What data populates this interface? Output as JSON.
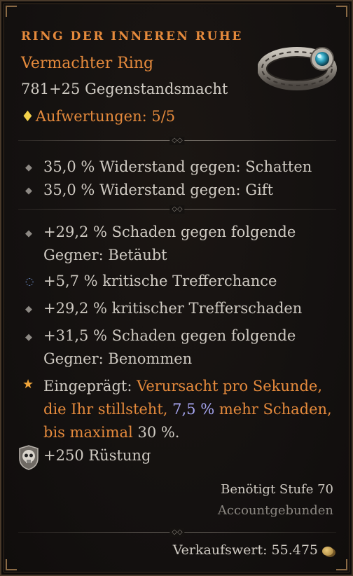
{
  "item": {
    "name": "RING DER INNEREN RUHE",
    "type": "Vermachter Ring",
    "power": "781+25 Gegenstandsmacht",
    "upgrades": "Aufwertungen: 5/5"
  },
  "resistances": [
    "35,0 % Widerstand gegen: Schatten",
    "35,0 % Widerstand gegen: Gift"
  ],
  "affixes": {
    "a1_line1": "+29,2 % Schaden gegen folgende",
    "a1_line2": "Gegner: Betäubt",
    "a2": "+5,7 % kritische Trefferchance",
    "a3": "+29,2 % kritischer Trefferschaden",
    "a4_line1": "+31,5 % Schaden gegen folgende",
    "a4_line2": "Gegner: Benommen"
  },
  "aspect": {
    "label": "Eingeprägt:",
    "part1": "Verursacht pro Sekunde,",
    "part2": "die Ihr stillsteht,",
    "value1": "7,5 %",
    "part3": "mehr Schaden,",
    "part4": "bis maximal",
    "value2": "30 %."
  },
  "armor": "+250 Rüstung",
  "requirement": "Benötigt Stufe 70",
  "binding": "Accountgebunden",
  "sell_value": "Verkaufswert: 55.475",
  "colors": {
    "legendary": "#e58a3c",
    "stat_text": "#cfcac2",
    "muted": "#8b8781",
    "aspect_value": "#a7a6f2"
  },
  "icons": {
    "upgrade": "diamond-icon",
    "affix": "small-diamond-bullet-icon",
    "crit": "ring-bullet-icon",
    "aspect": "star-icon",
    "armor": "skull-shield-icon",
    "gold": "gold-coin-icon"
  }
}
